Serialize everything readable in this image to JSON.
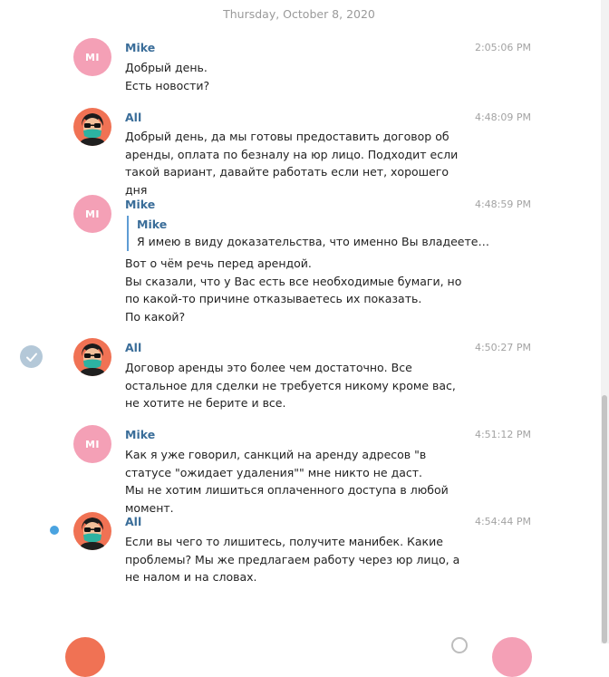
{
  "chat": {
    "date_header": "Thursday, October 8, 2020",
    "messages": [
      {
        "sender": "Mike",
        "avatar": "MI",
        "time": "2:05:06 PM",
        "text": "Добрый день.\nЕсть новости?"
      },
      {
        "sender": "All",
        "avatar_icon": "masked-man-avatar-icon",
        "time": "4:48:09 PM",
        "text": "Добрый день, да мы готовы предоставить договор об аренды, оплата по безналу на юр лицо. Подходит если такой вариант, давайте работать если нет, хорошего дня"
      },
      {
        "sender": "Mike",
        "avatar": "MI",
        "time": "4:48:59 PM",
        "reply_to": {
          "sender": "Mike",
          "text": "Я имею в виду доказательства, что именно Вы владеете ад..."
        },
        "text": "Вот о чём речь перед арендой.\nВы сказали, что у Вас есть все необходимые бумаги, но по какой-то причине отказываетесь их показать.\nПо какой?"
      },
      {
        "sender": "All",
        "avatar_icon": "masked-man-avatar-icon",
        "time": "4:50:27 PM",
        "selected": true,
        "text": "Договор аренды это более чем достаточно. Все остальное для сделки не требуется никому кроме вас, не хотите не берите и все."
      },
      {
        "sender": "Mike",
        "avatar": "MI",
        "time": "4:51:12 PM",
        "text": "Как я уже говорил, санкций на аренду адресов \"в статусе \"ожидает удаления\"\" мне никто не даст.\nМы не хотим лишиться оплаченного доступа в любой момент."
      },
      {
        "sender": "All",
        "avatar_icon": "masked-man-avatar-icon",
        "time": "4:54:44 PM",
        "unread": true,
        "text": "Если вы чего то лишитесь, получите манибек. Какие проблемы? Мы же предлагаем работу через юр лицо, а не налом и на словах."
      }
    ]
  },
  "colors": {
    "sender_name": "#3a6d99",
    "initials_avatar": "#f4a0b6",
    "picture_avatar": "#f07254",
    "reply_bar": "#5e9cd4",
    "unread_dot": "#4aa3e0",
    "selected_badge": "#b4c8d8"
  }
}
